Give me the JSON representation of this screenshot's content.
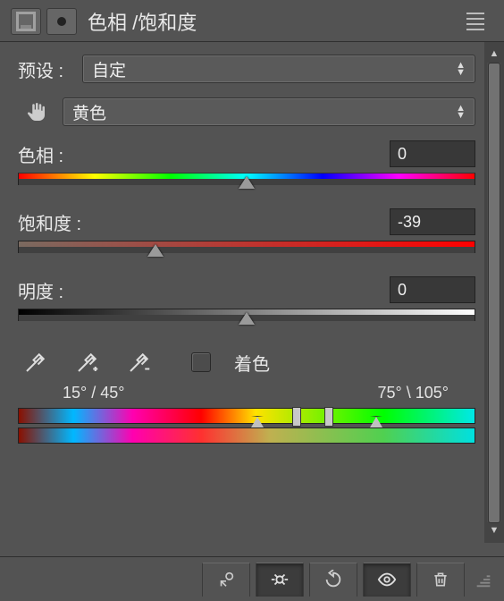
{
  "header": {
    "title": "色相 /饱和度"
  },
  "preset": {
    "label": "预设 :",
    "value": "自定"
  },
  "channel": {
    "value": "黄色"
  },
  "hue": {
    "label": "色相 :",
    "value": "0",
    "pos_pct": 50
  },
  "saturation": {
    "label": "饱和度 :",
    "value": "-39",
    "pos_pct": 30
  },
  "lightness": {
    "label": "明度 :",
    "value": "0",
    "pos_pct": 50
  },
  "colorize": {
    "label": "着色",
    "checked": false
  },
  "range": {
    "left_outer": "15°",
    "left_inner": "45°",
    "right_inner": "75°",
    "right_outer": "105°",
    "sep_left": "/",
    "sep_right": "\\"
  }
}
